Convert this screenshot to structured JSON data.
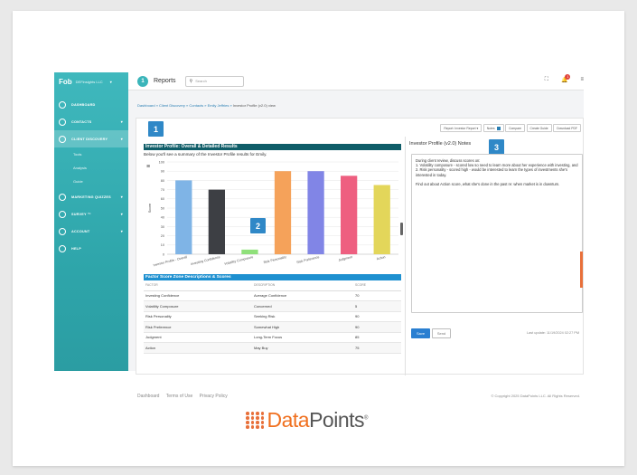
{
  "brand": {
    "logo": "Fob",
    "firm": "DEFinsights LLC",
    "logo_text_a": "Data",
    "logo_text_b": "Points",
    "trademark": "®"
  },
  "sidebar": {
    "items": [
      {
        "label": "DASHBOARD",
        "icon": "dashboard-icon"
      },
      {
        "label": "CONTACTS",
        "icon": "contacts-icon",
        "arrow": "▾"
      },
      {
        "label": "CLIENT DISCOVERY",
        "icon": "client-discovery-icon",
        "arrow": "▾",
        "active": true
      },
      {
        "label": "MARKETING QUIZZES",
        "icon": "quiz-icon",
        "arrow": "▾"
      },
      {
        "label": "SURVEY ™",
        "icon": "survey-icon",
        "arrow": "▾"
      },
      {
        "label": "ACCOUNT",
        "icon": "account-icon",
        "arrow": "▾"
      },
      {
        "label": "HELP",
        "icon": "help-icon"
      }
    ],
    "subitems": [
      "Tools",
      "Analysis",
      "Guide"
    ]
  },
  "topbar": {
    "step": "1",
    "title": "Reports",
    "search_placeholder": "Search",
    "notif_count": "1"
  },
  "breadcrumb": {
    "items": [
      "Dashboard",
      "Client Discovery",
      "Contacts",
      "Emily Jeffries"
    ],
    "current": "Investor Profile (v2.0) view",
    "sep": " » "
  },
  "badges": [
    "1",
    "2",
    "3"
  ],
  "toolbar": {
    "buttons": [
      "Report: Investor Report ▾",
      "Notes",
      "Compare",
      "Create Guide",
      "Download PDF"
    ]
  },
  "main": {
    "heading": "Investor Profile: Overall & Detailed Results",
    "subheading": "Below you'll see a summary of the Investor Profile results for Emily.",
    "table_heading": "Factor Score Zone Descriptions & Scores",
    "table_headers": [
      "FACTOR",
      "DESCRIPTION",
      "SCORE"
    ],
    "rows": [
      [
        "Investing Confidence",
        "Average Confidence",
        "70"
      ],
      [
        "Volatility Composure",
        "Concerned",
        "5"
      ],
      [
        "Risk Personality",
        "Seeking Risk",
        "90"
      ],
      [
        "Risk Preference",
        "Somewhat High",
        "90"
      ],
      [
        "Judgment",
        "Long-Term Focus",
        "85"
      ],
      [
        "Action",
        "May Buy",
        "75"
      ]
    ]
  },
  "chart_data": {
    "type": "bar",
    "categories": [
      "Investor Profile - Overall",
      "Investing Confidence",
      "Volatility Composure",
      "Risk Personality",
      "Risk Preference",
      "Judgment",
      "Action"
    ],
    "values": [
      80,
      70,
      5,
      90,
      90,
      85,
      75
    ],
    "colors": [
      "#7fb4e6",
      "#3d3f44",
      "#8fe07a",
      "#f5a25a",
      "#8185e6",
      "#ee5f80",
      "#e3d65a"
    ],
    "ylabel": "Score",
    "ylim": [
      0,
      100
    ],
    "yticks": [
      0,
      10,
      20,
      30,
      40,
      50,
      60,
      70,
      80,
      90,
      100
    ],
    "grid": true
  },
  "notes": {
    "title": "Investor Profile (v2.0) Notes",
    "body": "During client review, discuss scores on:\n1. Volatility composure - scored low so need to learn more about her experience with investing, and\n2. Risk personality - scored high - would be interested to learn the types of investments she's interested in today.\n\nFind out about Action score, what she's done in the past re: when market is in downturn.",
    "save": "Save",
    "send": "Send",
    "updated": "Last update: 11/19/2024 02:27 PM"
  },
  "footer": {
    "links": [
      "Dashboard",
      "Terms of Use",
      "Privacy Policy"
    ],
    "copyright": "© Copyright 2025 DataPoints LLC. All Rights Reserved."
  }
}
